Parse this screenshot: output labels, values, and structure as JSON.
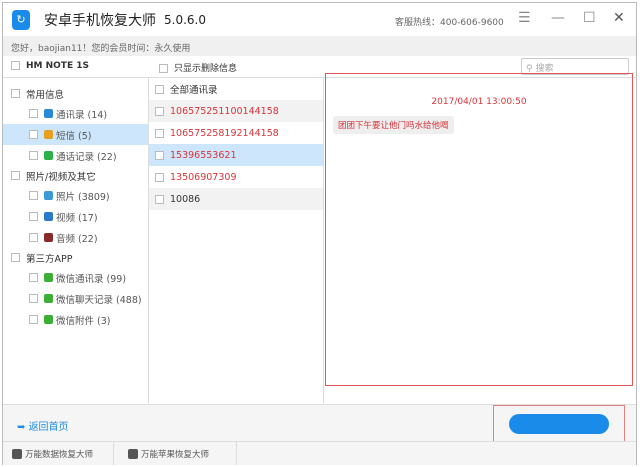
{
  "app": {
    "title": "安卓手机恢复大师",
    "version": "5.0.6.0",
    "hotline": "客服热线：400-606-9600",
    "greeting": "您好，baojian11！您的会员时间：永久使用"
  },
  "header": {
    "device": "HM NOTE 1S",
    "only_deleted": "只显示删除信息",
    "search_placeholder": "搜索"
  },
  "tree": [
    {
      "label": "常用信息",
      "level": 0
    },
    {
      "label": "通讯录 (14)",
      "level": 1,
      "color": "#2a8ad8"
    },
    {
      "label": "短信 (5)",
      "level": 1,
      "color": "#e6a020",
      "selected": true
    },
    {
      "label": "通话记录 (22)",
      "level": 1,
      "color": "#2bb14a"
    },
    {
      "label": "照片/视频及其它",
      "level": 0
    },
    {
      "label": "照片 (3809)",
      "level": 1,
      "color": "#3a9ad8"
    },
    {
      "label": "视频 (17)",
      "level": 1,
      "color": "#2a7ac8"
    },
    {
      "label": "音频 (22)",
      "level": 1,
      "color": "#8a2a2a"
    },
    {
      "label": "第三方APP",
      "level": 0
    },
    {
      "label": "微信通讯录 (99)",
      "level": 1,
      "color": "#3cb034"
    },
    {
      "label": "微信聊天记录 (488)",
      "level": 1,
      "color": "#3cb034"
    },
    {
      "label": "微信附件 (3)",
      "level": 1,
      "color": "#3cb034"
    }
  ],
  "list": [
    {
      "label": "全部通讯录",
      "style": ""
    },
    {
      "label": "106575251100144158",
      "style": "red g"
    },
    {
      "label": "106575258192144158",
      "style": "red"
    },
    {
      "label": "15396553621",
      "style": "red s"
    },
    {
      "label": "13506907309",
      "style": "red"
    },
    {
      "label": "10086",
      "style": "g"
    }
  ],
  "detail": {
    "datetime": "2017/04/01 13:00:50",
    "message": "团团下午要让他门吗水给他喝"
  },
  "bottom": {
    "back": "返回首页"
  },
  "footer": {
    "tab1": "万能数据恢复大师",
    "tab2": "万能苹果恢复大师"
  }
}
